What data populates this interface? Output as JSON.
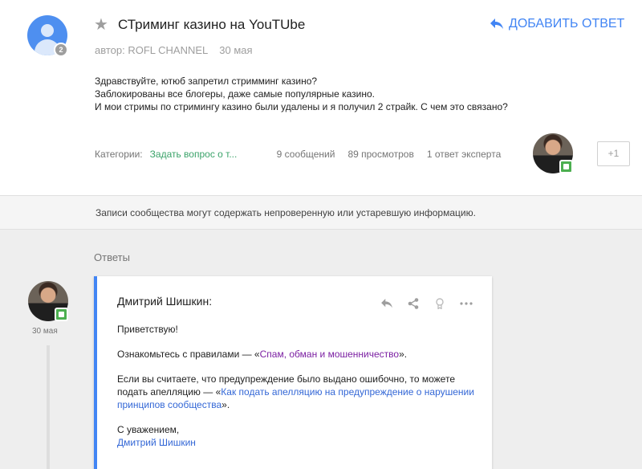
{
  "question": {
    "title": "СТриминг казино на YouTUbe",
    "author_label": "автор: ROFL CHANNEL",
    "date": "30 мая",
    "avatar_badge": "2",
    "reply_label": "ДОБАВИТЬ ОТВЕТ",
    "body": [
      "Здравствуйте, ютюб запретил стримминг казино?",
      "Заблокированы все блогеры, даже самые популярные казино.",
      "И мои стримы по стримингу казино были удалены и я получил 2 страйк. С чем это связано?"
    ],
    "categories_label": "Категории:",
    "category_link": "Задать вопрос о т...",
    "messages": "9 сообщений",
    "views": "89 просмотров",
    "expert_answers": "1 ответ эксперта",
    "plus_one": "+1"
  },
  "notice": "Записи сообщества могут содержать непроверенную или устаревшую информацию.",
  "answers": {
    "label": "Ответы",
    "items": [
      {
        "author": "Дмитрий Шишкин:",
        "date": "30 мая",
        "greeting": "Приветствую!",
        "rules_prefix": "Ознакомьтесь с правилами — «",
        "rules_link": "Спам, обман и мошенничество",
        "rules_suffix": "».",
        "appeal_prefix": "Если вы считаете, что предупреждение было выдано ошибочно, то можете подать апелляцию — «",
        "appeal_link": "Как подать апелляцию на предупреждение о нарушении принципов сообщества",
        "appeal_suffix": "».",
        "signoff": "С уважением,",
        "signature": "Дмитрий Шишкин"
      }
    ]
  },
  "colors": {
    "accent": "#4285f4",
    "category_link": "#3ba36a",
    "expert_badge": "#4caf50",
    "link_purple": "#7b1fa2"
  },
  "icons": {
    "star": "star-icon",
    "reply": "reply-icon",
    "share": "share-icon",
    "mark_best": "award-icon",
    "more": "more-icon"
  }
}
